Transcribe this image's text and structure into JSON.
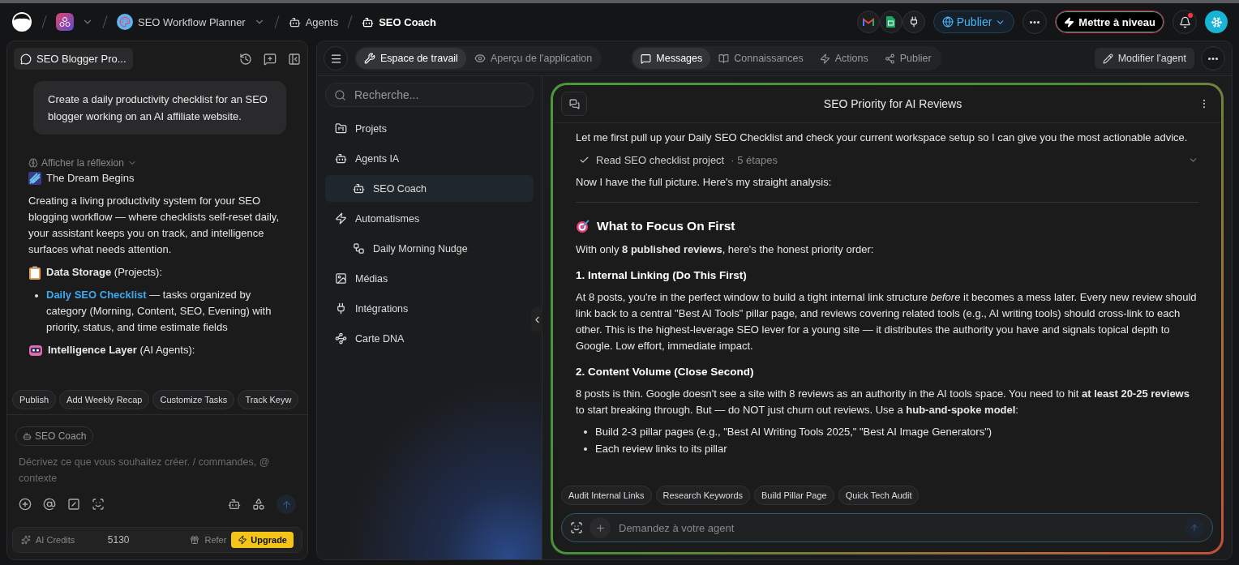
{
  "topbar": {
    "breadcrumbs": [
      {
        "kind": "app"
      },
      {
        "kind": "project",
        "label": "SEO Workflow Planner"
      },
      {
        "kind": "section",
        "label": "Agents"
      },
      {
        "kind": "current",
        "label": "SEO Coach"
      }
    ],
    "publish": "Publier",
    "upgrade": "Mettre à niveau",
    "notifications": {
      "unread": true
    }
  },
  "left_panel": {
    "conversation": "SEO Blogger Pro...",
    "user_message": "Create a daily productivity checklist for an SEO blogger working on an AI affiliate website.",
    "thinking_toggle": "Afficher la réflexion",
    "title": "The Dream Begins",
    "paragraph": "Creating a living productivity system for your SEO blogging workflow — where checklists self-reset daily, your assistant keeps you on track, and intelligence surfaces what needs attention.",
    "sections": [
      {
        "kind": "storage",
        "heading": "**Data Storage** (Projects):",
        "bullets": [
          {
            "link": "Daily SEO Checklist",
            "text": "— tasks organized by category (Morning, Content, SEO, Evening) with priority, status, and time estimate fields"
          }
        ]
      },
      {
        "kind": "agents",
        "heading": "**Intelligence Layer** (AI Agents):"
      }
    ],
    "suggestions": [
      "Publish",
      "Add Weekly Recap",
      "Customize Tasks",
      "Track Keyw"
    ],
    "agent_tag": "SEO Coach",
    "composer": {
      "placeholder": "Décrivez ce que vous souhaitez créer. / commandes, @ contexte"
    },
    "footer": {
      "credits_label": "AI Credits",
      "credits": "5130",
      "refer": "Refer",
      "upgrade": "Upgrade"
    }
  },
  "toolbar": {
    "modes": [
      {
        "label": "Espace de travail",
        "selected": true
      },
      {
        "label": "Aperçu de l'application",
        "selected": false
      }
    ],
    "tabs": [
      {
        "label": "Messages",
        "selected": true
      },
      {
        "label": "Connaissances",
        "selected": false
      },
      {
        "label": "Actions",
        "selected": false
      },
      {
        "label": "Publier",
        "selected": false
      }
    ],
    "edit_agent": "Modifier l'agent"
  },
  "sidebar": {
    "search": {
      "placeholder": "Recherche..."
    },
    "items": [
      {
        "label": "Projets",
        "selected": false
      },
      {
        "label": "Agents IA",
        "selected": false,
        "children": [
          {
            "label": "SEO Coach",
            "selected": true
          }
        ]
      },
      {
        "label": "Automatismes",
        "selected": false,
        "children": [
          {
            "label": "Daily Morning Nudge",
            "selected": false
          }
        ]
      },
      {
        "label": "Médias",
        "selected": false
      },
      {
        "label": "Intégrations",
        "selected": false
      },
      {
        "label": "Carte DNA",
        "selected": false
      }
    ]
  },
  "chat": {
    "title": "SEO Priority for AI Reviews",
    "blocks": [
      {
        "kind": "p",
        "text": "Let me first pull up your Daily SEO Checklist and check your current workspace setup so I can give you the most actionable advice."
      },
      {
        "kind": "step",
        "text": "Read SEO checklist project",
        "meta": "· 5 étapes",
        "done": true
      },
      {
        "kind": "p",
        "text": "Now I have the full picture. Here's my straight analysis:"
      },
      {
        "kind": "rule"
      },
      {
        "kind": "h2",
        "text": "What to Focus On First"
      },
      {
        "kind": "p",
        "text": "With only **8 published reviews**, here's the honest priority order:"
      },
      {
        "kind": "h3",
        "text": "1. Internal Linking (Do This First)"
      },
      {
        "kind": "p",
        "text": "At 8 posts, you're in the perfect window to build a tight internal link structure *before* it becomes a mess later. Every new review should link back to a central \"Best AI Tools\" pillar page, and reviews covering related tools (e.g., AI writing tools) should cross-link to each other. This is the highest-leverage SEO lever for a young site — it distributes the authority you have and signals topical depth to Google. Low effort, immediate impact."
      },
      {
        "kind": "h3",
        "text": "2. Content Volume (Close Second)"
      },
      {
        "kind": "p",
        "text": "8 posts is thin. Google doesn't see a site with 8 reviews as an authority in the AI tools space. You need to hit **at least 20-25 reviews** to start breaking through. But — do NOT just churn out reviews. Use a **hub-and-spoke model**:"
      },
      {
        "kind": "list",
        "items": [
          "Build 2-3 pillar pages (e.g., \"Best AI Writing Tools 2025,\" \"Best AI Image Generators\")",
          "Each review links to its pillar"
        ]
      }
    ],
    "suggestions": [
      "Audit Internal Links",
      "Research Keywords",
      "Build Pillar Page",
      "Quick Tech Audit"
    ],
    "input": {
      "placeholder": "Demandez à votre agent"
    }
  }
}
